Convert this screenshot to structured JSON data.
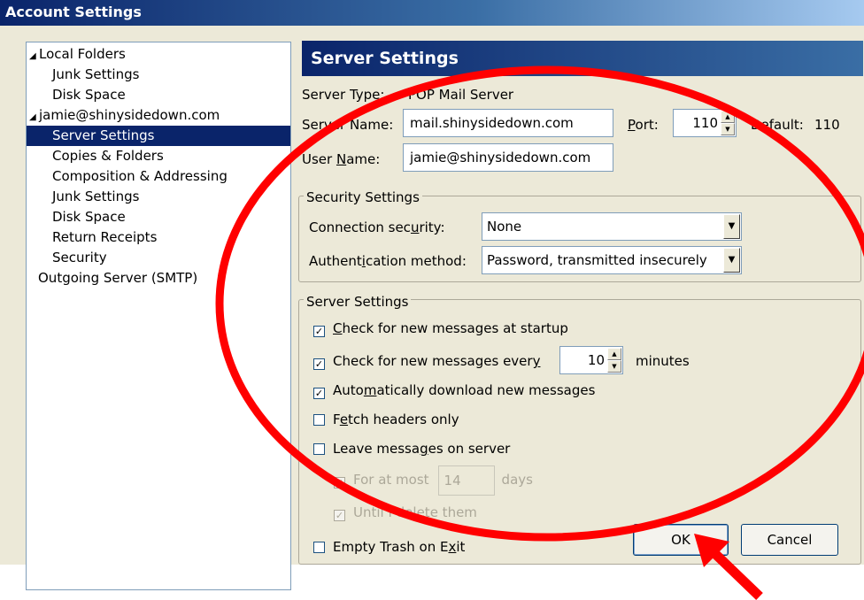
{
  "window": {
    "title": "Account Settings"
  },
  "tree": {
    "items": [
      {
        "label": "Local Folders",
        "expander": "◢"
      },
      {
        "label": "Junk Settings"
      },
      {
        "label": "Disk Space"
      },
      {
        "label": "jamie@shinysidedown.com",
        "expander": "◢"
      },
      {
        "label": "Server Settings",
        "selected": true
      },
      {
        "label": "Copies & Folders"
      },
      {
        "label": "Composition & Addressing"
      },
      {
        "label": "Junk Settings"
      },
      {
        "label": "Disk Space"
      },
      {
        "label": "Return Receipts"
      },
      {
        "label": "Security"
      },
      {
        "label": "Outgoing Server (SMTP)"
      }
    ]
  },
  "panel": {
    "header": "Server Settings",
    "server_type_label": "Server Type:",
    "server_type_value": "POP Mail Server",
    "server_name_label_pre": "Server Name:",
    "server_name_value": "mail.shinysidedown.com",
    "port_label_key": "P",
    "port_label_rest": "ort:",
    "port_value": "110",
    "default_label": "Default:",
    "default_value": "110",
    "user_name_pre": "User ",
    "user_name_key": "N",
    "user_name_post": "ame:",
    "user_name_value": "jamie@shinysidedown.com"
  },
  "security": {
    "legend": "Security Settings",
    "connection_pre": "Connection sec",
    "connection_key": "u",
    "connection_post": "rity:",
    "connection_value": "None",
    "auth_pre": "Authent",
    "auth_key": "i",
    "auth_post": "cation method:",
    "auth_value": "Password, transmitted insecurely"
  },
  "server_settings": {
    "legend": "Server Settings",
    "startup_key": "C",
    "startup_rest": "heck for new messages at startup",
    "startup_checked": "☑",
    "every_pre": "Check for new messages ever",
    "every_key": "y",
    "every_value": "10",
    "every_unit": "minutes",
    "auto_pre": "Auto",
    "auto_key": "m",
    "auto_post": "atically download new messages",
    "fetch_pre": "F",
    "fetch_key": "e",
    "fetch_post": "tch headers only",
    "leave_pre": "Leave messa",
    "leave_key": "g",
    "leave_post": "es on server",
    "for_at_most": "For at most",
    "for_at_most_value": "14",
    "days": "days",
    "until_delete": "Until I delete them",
    "empty_pre": "Empty Trash on E",
    "empty_key": "x",
    "empty_post": "it",
    "check_mark": "✓"
  },
  "buttons": {
    "ok": "OK",
    "cancel": "Cancel"
  },
  "colors": {
    "annotation": "#ff0000",
    "selection": "#0a246a",
    "header": "#0a246a"
  }
}
